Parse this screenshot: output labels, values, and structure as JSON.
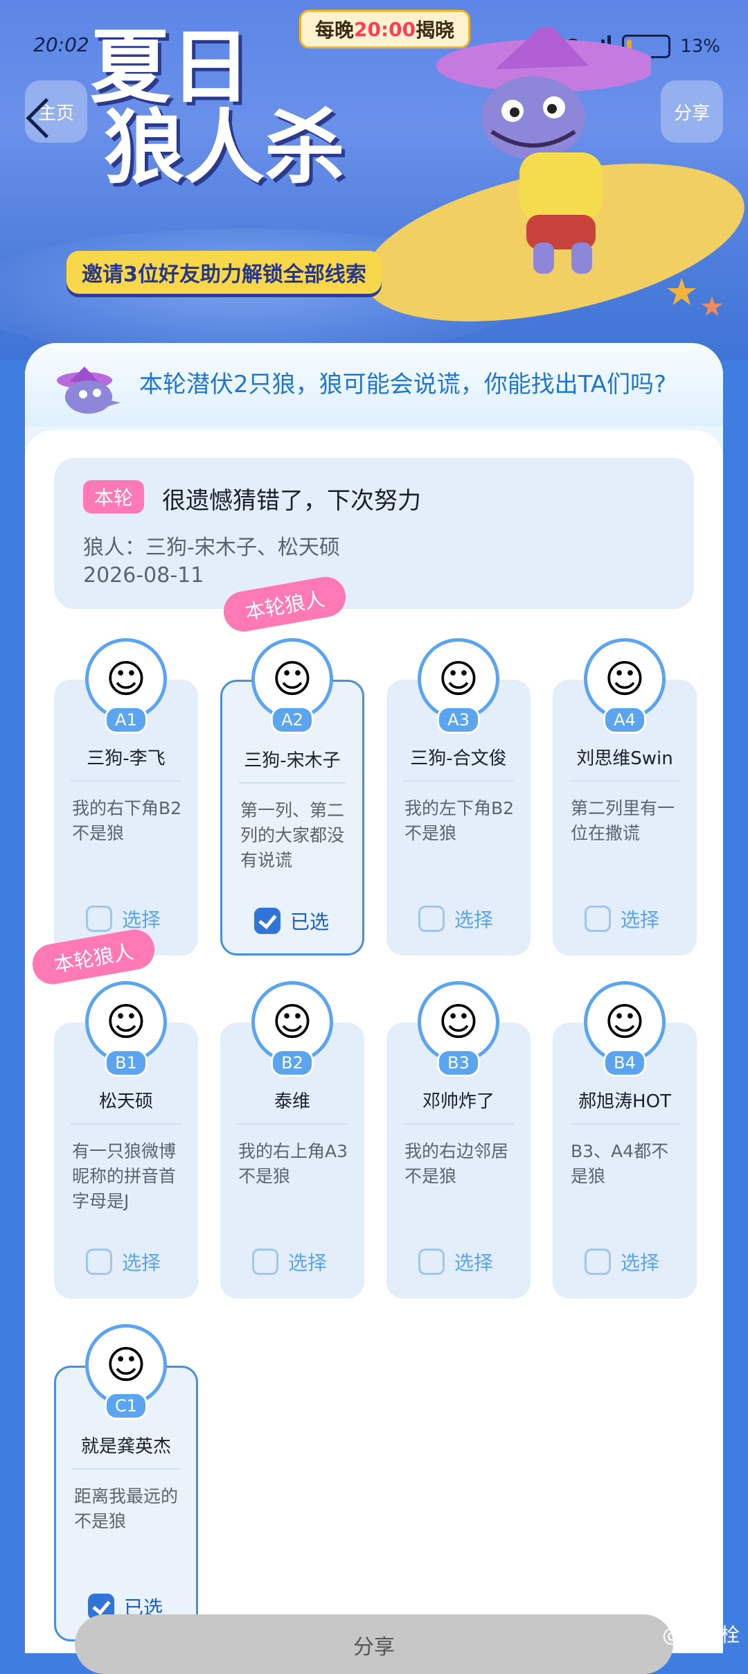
{
  "status_bar": {
    "time": "20:02",
    "network": "5G",
    "battery": "13%",
    "battery_level": 0.13
  },
  "hero": {
    "reveal_prefix": "每晚",
    "reveal_time": "20:00",
    "reveal_suffix": "揭晓",
    "title_line1": "夏日",
    "title_line2": "狼人杀",
    "home_label": "主页",
    "share_label": "分享",
    "subtitle": "邀请3位好友助力解锁全部线索"
  },
  "panel": {
    "headline": "本轮潜伏2只狼，狼可能会说谎，你能找出TA们吗?",
    "result": {
      "tag": "本轮",
      "title": "很遗憾猜错了，下次努力",
      "wolves": "狼人：三狗-宋木子、松天硕",
      "date": "2026-08-11"
    },
    "wolf_tag_label": "本轮狼人",
    "choose_label": "选择",
    "chosen_label": "已选"
  },
  "players": [
    {
      "seat": "A1",
      "name": "三狗-李飞",
      "claim": "我的右下角B2不是狼",
      "selected": false,
      "avatar_icon": "okboom-avatar-icon"
    },
    {
      "seat": "A2",
      "name": "三狗-宋木子",
      "claim": "第一列、第二列的大家都没有说谎",
      "selected": true,
      "avatar_icon": "horned-face-avatar-icon"
    },
    {
      "seat": "A3",
      "name": "三狗-合文俊",
      "claim": "我的左下角B2不是狼",
      "selected": false,
      "avatar_icon": "cartoon-man-avatar-icon"
    },
    {
      "seat": "A4",
      "name": "刘思维Swin",
      "claim": "第二列里有一位在撒谎",
      "selected": false,
      "avatar_icon": "photo-man-avatar-icon"
    },
    {
      "seat": "B1",
      "name": "松天硕",
      "claim": "有一只狼微博昵称的拼音首字母是J",
      "selected": false,
      "avatar_icon": "photo-boy-avatar-icon"
    },
    {
      "seat": "B2",
      "name": "泰维",
      "claim": "我的右上角A3不是狼",
      "selected": false,
      "avatar_icon": "wedding-photo-avatar-icon"
    },
    {
      "seat": "B3",
      "name": "邓帅炸了",
      "claim": "我的右边邻居不是狼",
      "selected": false,
      "avatar_icon": "okboom-orange-avatar-icon"
    },
    {
      "seat": "B4",
      "name": "郝旭涛HOT",
      "claim": "B3、A4都不是狼",
      "selected": false,
      "avatar_icon": "glasses-man-avatar-icon"
    },
    {
      "seat": "C1",
      "name": "就是龚英杰",
      "claim": "距离我最远的不是狼",
      "selected": true,
      "avatar_icon": "sketch-face-avatar-icon"
    }
  ],
  "bottom": {
    "share_label": "分享",
    "watermark": "@霎核栓"
  },
  "colors": {
    "accent": "#5aa4f0",
    "wolf_tag": "#ff7ab4",
    "highlight": "#ff3d56"
  }
}
